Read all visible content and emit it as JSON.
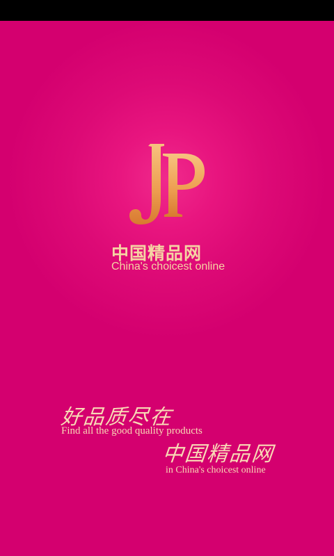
{
  "brand": {
    "monogram": "JP",
    "name_cn": "中国精品网",
    "name_en": "China's choicest online"
  },
  "tagline": {
    "line1_cn": "好品质尽在",
    "line1_en": "Find all the good quality products",
    "line2_cn": "中国精品网",
    "line2_en": "in China's choicest online"
  },
  "colors": {
    "background": "#d4006f",
    "glow": "#f02a8c",
    "logo_gold": "#f0a85a",
    "text_cream": "#f8d9b5",
    "status_bar": "#000000"
  }
}
